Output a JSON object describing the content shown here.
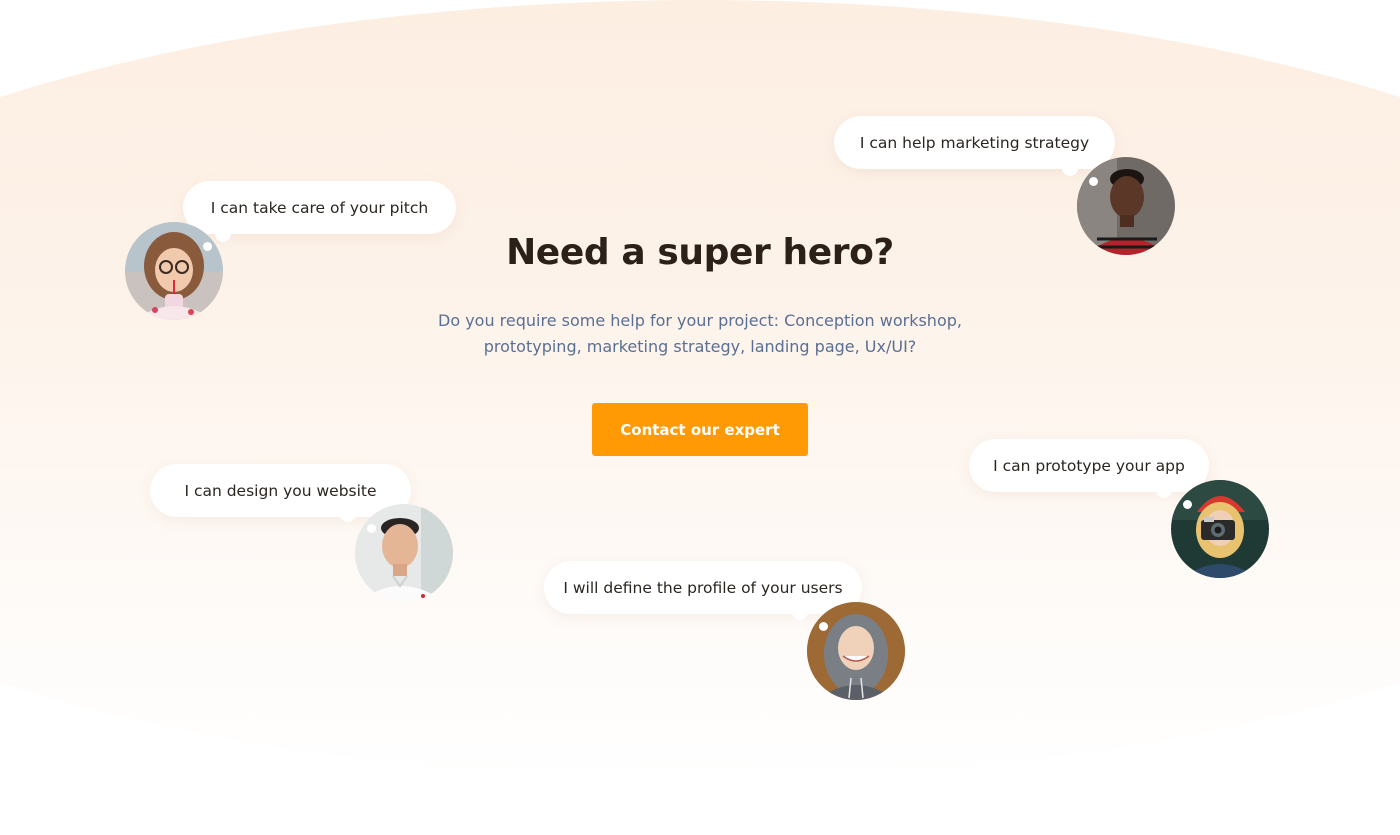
{
  "hero": {
    "title": "Need a super hero?",
    "subtitle_line1": "Do you require some help for your project: Conception workshop,",
    "subtitle_line2": "prototyping, marketing strategy, landing page, Ux/UI?",
    "cta_label": "Contact our expert"
  },
  "experts": [
    {
      "quote": "I can take care of your pitch"
    },
    {
      "quote": "I can help marketing strategy"
    },
    {
      "quote": "I can design you website"
    },
    {
      "quote": "I can prototype your app"
    },
    {
      "quote": "I will define the profile of your users"
    }
  ],
  "colors": {
    "accent": "#ff9a05",
    "title": "#2b2118",
    "subtitle": "#5a6f94"
  }
}
